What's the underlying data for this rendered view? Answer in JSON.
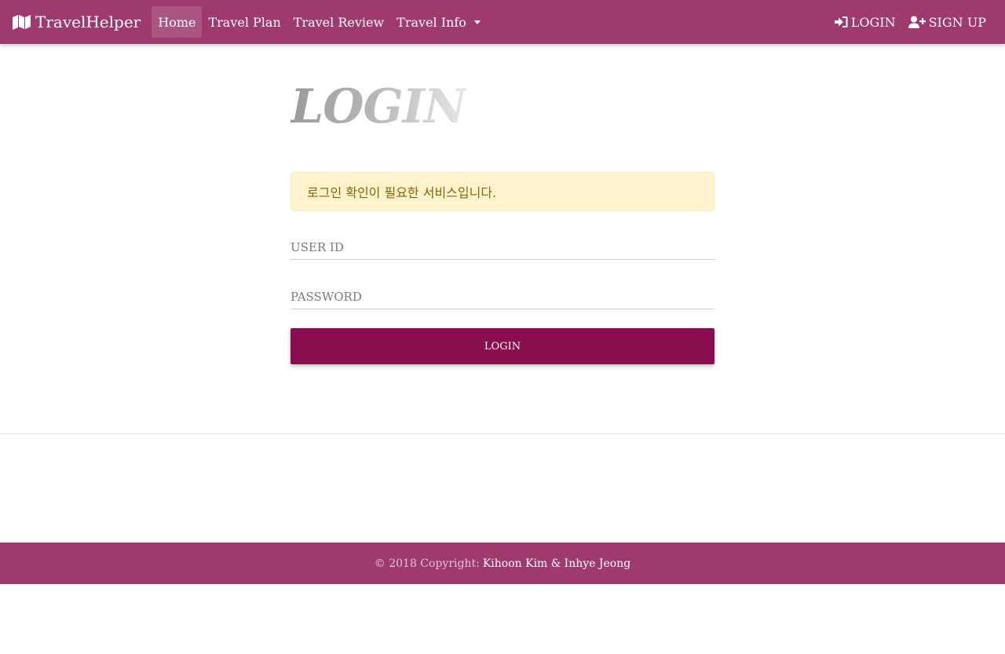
{
  "navbar": {
    "brand": "TravelHelper",
    "brand_icon": "map-icon",
    "items": [
      {
        "label": "Home",
        "active": true
      },
      {
        "label": "Travel Plan"
      },
      {
        "label": "Travel Review"
      },
      {
        "label": "Travel Info",
        "dropdown": true
      }
    ],
    "right": {
      "login": {
        "label": "LOGIN",
        "icon": "sign-in-icon"
      },
      "signup": {
        "label": "SIGN UP",
        "icon": "user-plus-icon"
      }
    },
    "color": "#9e3a6e"
  },
  "main": {
    "title": "LOGIN",
    "alert": "로그인 확인이 필요한 서비스입니다.",
    "userid_placeholder": "USER ID",
    "password_placeholder": "PASSWORD",
    "login_button": "LOGIN",
    "button_color": "#880e4f"
  },
  "footer": {
    "copyright": "© 2018 Copyright:",
    "authors": "Kihoon Kim & Inhye Jeong"
  }
}
